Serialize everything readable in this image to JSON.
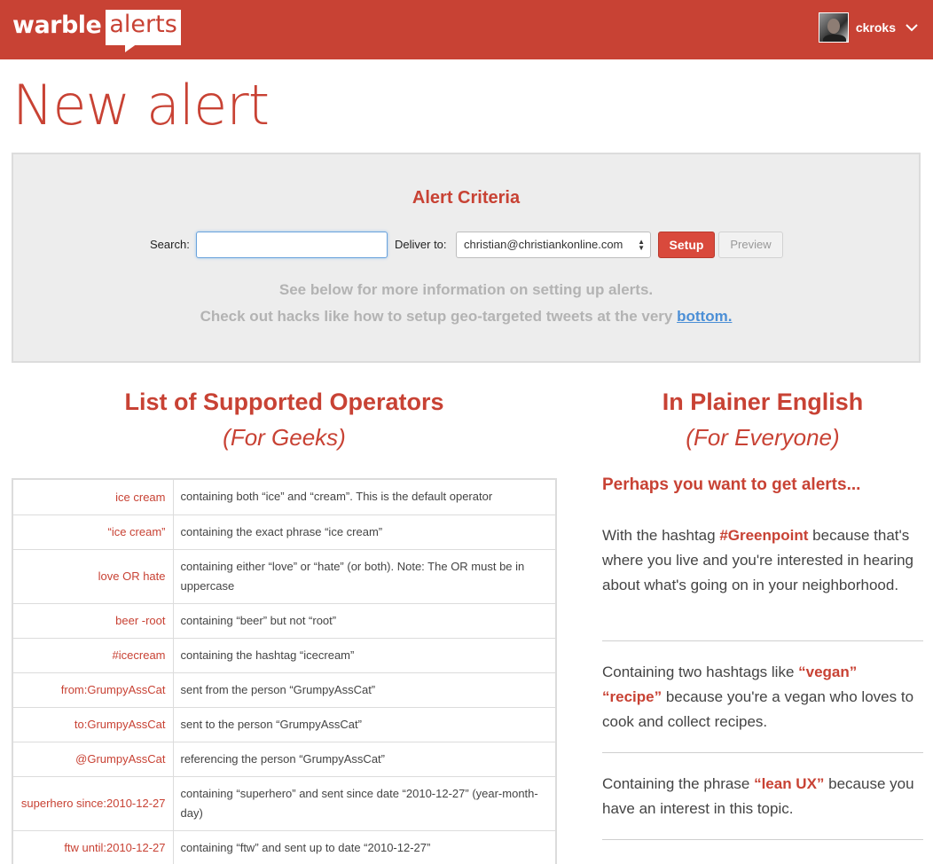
{
  "header": {
    "logo_main": "warble",
    "logo_badge": "alerts",
    "username": "ckroks"
  },
  "page_title": "New alert",
  "criteria": {
    "title": "Alert Criteria",
    "search_label": "Search:",
    "search_value": "",
    "deliver_label": "Deliver to:",
    "deliver_value": "christian@christiankonline.com",
    "setup_label": "Setup",
    "preview_label": "Preview",
    "info_line1": "See below for more information on setting up alerts.",
    "info_line2": "Check out hacks like how to setup geo-targeted tweets at the very",
    "info_link": "bottom."
  },
  "operators": {
    "heading": "List of Supported Operators",
    "subheading": "(For Geeks)",
    "rows": [
      {
        "op": "ice cream",
        "desc": "containing both “ice” and “cream”. This is the default operator"
      },
      {
        "op": "“ice cream”",
        "desc": "containing the exact phrase “ice cream”"
      },
      {
        "op": "love OR hate",
        "desc": "containing either “love” or “hate” (or both). Note: The OR must be in uppercase"
      },
      {
        "op": "beer -root",
        "desc": "containing “beer” but not “root”"
      },
      {
        "op": "#icecream",
        "desc": "containing the hashtag “icecream”"
      },
      {
        "op": "from:GrumpyAssCat",
        "desc": "sent from the person “GrumpyAssCat”"
      },
      {
        "op": "to:GrumpyAssCat",
        "desc": "sent to the person “GrumpyAssCat”"
      },
      {
        "op": "@GrumpyAssCat",
        "desc": "referencing the person “GrumpyAssCat”"
      },
      {
        "op": "superhero since:2010-12-27",
        "desc": "containing “superhero” and sent since date “2010-12-27” (year-month-day)"
      },
      {
        "op": "ftw until:2010-12-27",
        "desc": "containing “ftw” and sent up to date “2010-12-27”"
      }
    ]
  },
  "plain": {
    "heading": "In Plainer English",
    "subheading": "(For Everyone)",
    "intro": "Perhaps you want to get alerts...",
    "ex1_pre": "With the hashtag ",
    "ex1_bold": "#Greenpoint",
    "ex1_post": " because that's where you live and you're interested in hearing about what's going on in your neighborhood.",
    "ex2_pre": "Containing two hashtags like ",
    "ex2_bold1": "“vegan”",
    "ex2_bold2": "“recipe”",
    "ex2_post": " because you're a vegan who loves to cook and collect recipes.",
    "ex3_pre": "Containing the phrase ",
    "ex3_bold": "“lean UX”",
    "ex3_post": " because you have an interest in this topic."
  },
  "colors": {
    "brand": "#c84234",
    "link": "#4c8fd6",
    "panel_bg": "#ededed"
  },
  "icons": {
    "user_menu": "chevron-down-icon",
    "select_arrows": "up-down-arrows-icon"
  }
}
